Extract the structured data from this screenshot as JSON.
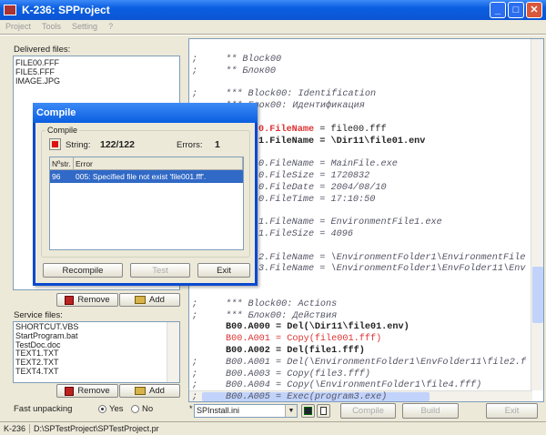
{
  "window": {
    "title": "K-236: SPProject"
  },
  "menu": [
    "Project",
    "Tools",
    "Setting",
    "?"
  ],
  "delivered": {
    "label": "Delivered files:",
    "items": [
      "FILE00.FFF",
      "FILE5.FFF",
      "IMAGE.JPG"
    ],
    "remove": "Remove",
    "add": "Add"
  },
  "service": {
    "label": "Service files:",
    "items": [
      "SHORTCUT.VBS",
      "StartProgram.bat",
      "TestDoc.doc",
      "TEXT1.TXT",
      "TEXT2.TXT",
      "TEXT4.TXT"
    ],
    "remove": "Remove",
    "add": "Add"
  },
  "fast_unpacking": {
    "label": "Fast unpacking",
    "yes": "Yes",
    "no": "No",
    "selected": "Yes"
  },
  "code": [
    {
      "t": "** Block00",
      "c": "cmt",
      "s": true
    },
    {
      "t": "** Блок00",
      "c": "cmt",
      "s": true
    },
    {
      "t": "*** Block00: Identification",
      "c": "cmt",
      "s": true
    },
    {
      "t": "*** Блок00: Идентификация",
      "c": "cmt",
      "s": false
    },
    {
      "t": "0.FileName = file00.fff",
      "c": "hl",
      "s": false
    },
    {
      "t": "1.FileName = \\Dir11\\file01.env",
      "c": "b",
      "s": false
    },
    {
      "t": "0.FileName = MainFile.exe",
      "c": "cmt",
      "s": false
    },
    {
      "t": "0.FileSize = 1720832",
      "c": "cmt",
      "s": false
    },
    {
      "t": "0.FileDate = 2004/08/10",
      "c": "cmt",
      "s": false
    },
    {
      "t": "0.FileTime = 17:10:50",
      "c": "cmt",
      "s": false
    },
    {
      "t": "1.FileName = EnvironmentFile1.exe",
      "c": "cmt",
      "s": false
    },
    {
      "t": "1.FileSize = 4096",
      "c": "cmt",
      "s": false
    },
    {
      "t": "2.FileName = \\EnvironmentFolder1\\EnvironmentFile",
      "c": "cmt",
      "s": false
    },
    {
      "t": "3.FileName = \\EnvironmentFolder1\\EnvFolder11\\Env",
      "c": "cmt",
      "s": false
    },
    {
      "t": "*** Block00: Actions",
      "c": "cmt",
      "s": true
    },
    {
      "t": "*** Блок00: Действия",
      "c": "cmt",
      "s": true
    },
    {
      "t": "B00.A000 = Del(\\Dir11\\file01.env)",
      "c": "b",
      "s": false
    },
    {
      "t": "B00.A001 = Copy(file001.fff)",
      "c": "red",
      "s": false
    },
    {
      "t": "B00.A002 = Del(file1.fff)",
      "c": "b",
      "s": false
    },
    {
      "t": "B00.A001 = Del(\\EnvironmentFolder1\\EnvFolder11\\file2.f",
      "c": "cmt",
      "s": true
    },
    {
      "t": "B00.A003 = Copy(file3.fff)",
      "c": "cmt",
      "s": true
    },
    {
      "t": "B00.A004 = Copy(\\EnvironmentFolder1\\file4.fff)",
      "c": "cmt",
      "s": true
    },
    {
      "t": "B00.A005 = Exec(program3.exe)",
      "c": "cmt",
      "s": true
    }
  ],
  "toolbar": {
    "file": "SPInstall.ini",
    "compile": "Compile",
    "build": "Build",
    "exit": "Exit"
  },
  "status": {
    "id": "K-236",
    "path": "D:\\SPTestProject\\SPTestProject.pr"
  },
  "dialog": {
    "title": "Compile",
    "group": "Compile",
    "string_label": "String:",
    "string_value": "122/122",
    "errors_label": "Errors:",
    "errors_value": "1",
    "columns": [
      "Nºstr.",
      "Error"
    ],
    "rows": [
      {
        "n": "96",
        "error": "005: Specified file not exist 'file001.fff'."
      }
    ],
    "recompile": "Recompile",
    "test": "Test",
    "exit": "Exit"
  }
}
